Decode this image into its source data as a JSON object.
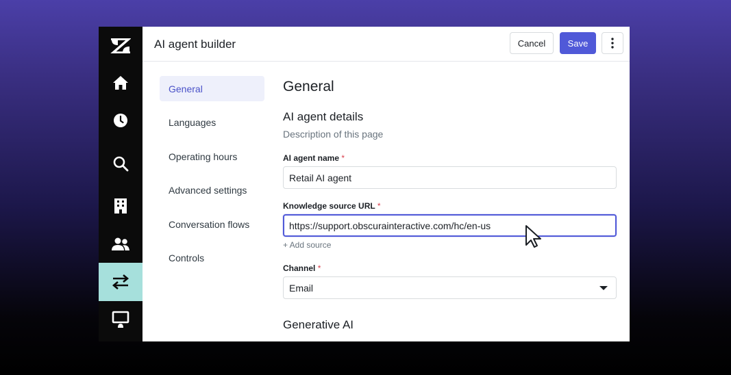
{
  "header": {
    "title": "AI agent builder",
    "cancel_label": "Cancel",
    "save_label": "Save",
    "more_icon": "kebab-icon"
  },
  "nav": {
    "logo": "zendesk-logo",
    "items": [
      {
        "icon": "home-icon"
      },
      {
        "icon": "clock-icon"
      },
      {
        "icon": "search-icon"
      },
      {
        "icon": "building-icon"
      },
      {
        "icon": "users-icon"
      },
      {
        "icon": "swap-arrows-icon",
        "active": true
      },
      {
        "icon": "monitor-icon"
      }
    ],
    "active_color": "#a6e0dc"
  },
  "submenu": {
    "items": [
      {
        "label": "General",
        "active": true
      },
      {
        "label": "Languages"
      },
      {
        "label": "Operating hours"
      },
      {
        "label": "Advanced settings"
      },
      {
        "label": "Conversation flows"
      },
      {
        "label": "Controls"
      }
    ]
  },
  "form": {
    "heading": "General",
    "section_title": "AI agent details",
    "section_description": "Description of this page",
    "agent_name_label": "AI agent name",
    "agent_name_value": "Retail AI agent",
    "knowledge_label": "Knowledge source URL",
    "knowledge_value": "https://support.obscurainteractive.com/hc/en-us",
    "add_source": "+ Add source",
    "channel_label": "Channel",
    "channel_value": "Email",
    "required_mark": "*",
    "generative_heading": "Generative AI"
  },
  "colors": {
    "primary": "#5059d8",
    "required": "#d93f4c"
  }
}
